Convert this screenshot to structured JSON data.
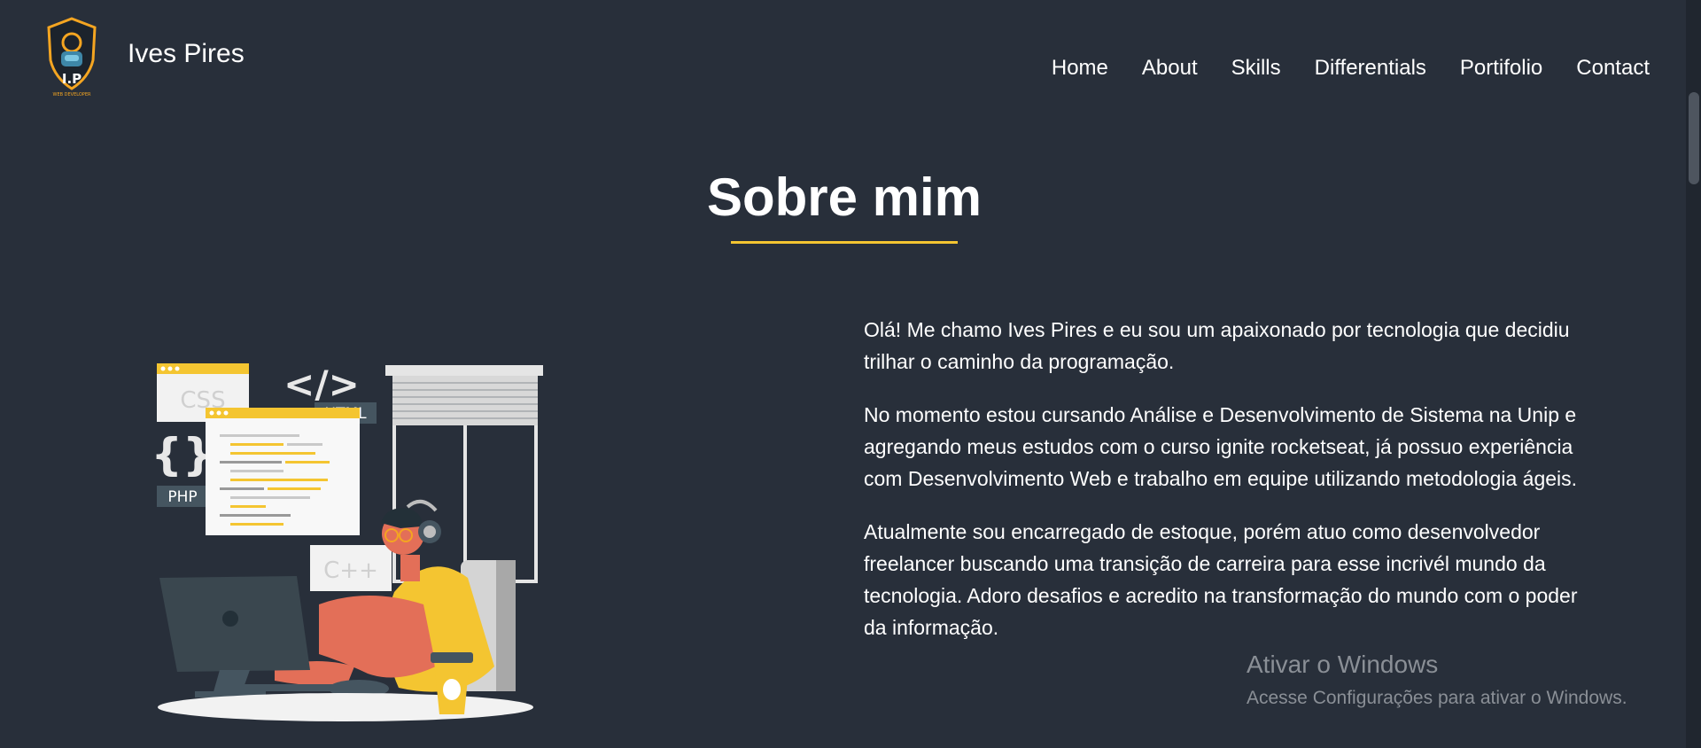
{
  "header": {
    "brand": "Ives Pires",
    "logo_caption": "WEB DEVELOPER",
    "logo_monogram": "I.P",
    "nav": [
      {
        "label": "Home"
      },
      {
        "label": "About"
      },
      {
        "label": "Skills"
      },
      {
        "label": "Differentials"
      },
      {
        "label": "Portifolio"
      },
      {
        "label": "Contact"
      }
    ]
  },
  "about": {
    "title": "Sobre mim",
    "paragraphs": [
      "Olá! Me chamo Ives Pires e eu sou um apaixonado por tecnologia que decidiu trilhar o caminho da programação.",
      "No momento estou cursando Análise e Desenvolvimento de Sistema na Unip e agregando meus estudos com o curso ignite rocketseat, já possuo experiência com Desenvolvimento Web e trabalho em equipe utilizando metodologia ágeis.",
      "Atualmente sou encarregado de estoque, porém atuo como desenvolvedor freelancer buscando uma transição de carreira para esse incrivél mundo da tecnologia. Adoro desafios e acredito na transformação do mundo com o poder da informação."
    ]
  },
  "illustration": {
    "labels": {
      "css": "CSS",
      "html": "HTML",
      "php": "PHP",
      "cpp": "C++",
      "code_tag": "</>"
    }
  },
  "windows_activation": {
    "title": "Ativar o Windows",
    "subtitle": "Acesse Configurações para ativar o Windows."
  },
  "colors": {
    "background": "#282f3a",
    "accent": "#f4c531",
    "text": "#ffffff"
  }
}
